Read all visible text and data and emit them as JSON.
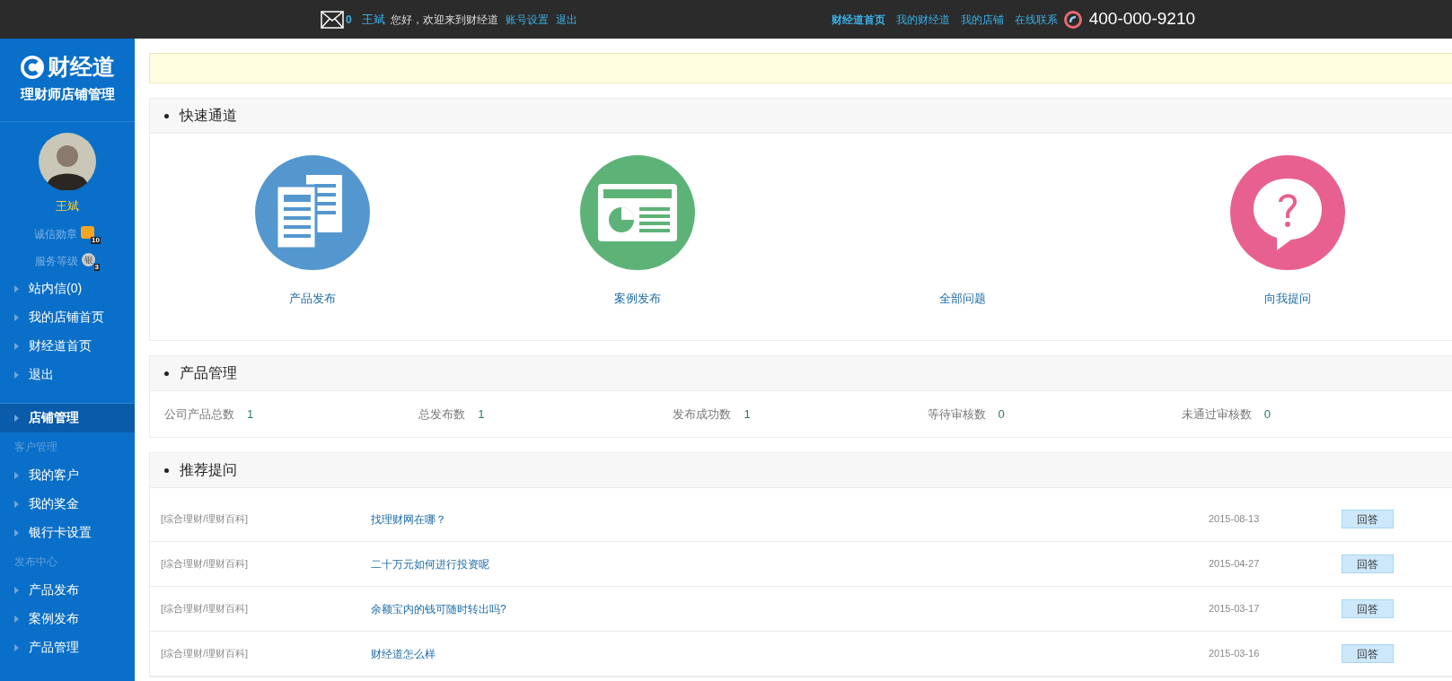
{
  "top_bar": {
    "mail_count": "0",
    "user": "王斌",
    "greeting": "您好，欢迎来到财经道",
    "links": [
      "账号设置",
      "退出"
    ],
    "nav": [
      {
        "label": "财经道首页",
        "selected": true
      },
      {
        "label": "我的财经道",
        "selected": false
      },
      {
        "label": "我的店铺",
        "selected": false
      },
      {
        "label": "在线联系",
        "selected": false
      }
    ],
    "phone": "400-000-9210"
  },
  "sidebar": {
    "logo": "财经道",
    "subtitle": "理财师店铺管理",
    "user_name": "王斌",
    "badges": [
      {
        "label": "诚信勋章",
        "kind": "medal",
        "count": "10"
      },
      {
        "label": "服务等级",
        "kind": "level",
        "glyph": "银",
        "count": "3"
      }
    ],
    "quick_links": [
      {
        "label": "站内信(0)"
      },
      {
        "label": "我的店铺首页"
      },
      {
        "label": "财经道首页"
      },
      {
        "label": "退出"
      }
    ],
    "menu": [
      {
        "kind": "item",
        "label": "店铺管理",
        "selected": true
      },
      {
        "kind": "group",
        "label": "客户管理"
      },
      {
        "kind": "item",
        "label": "我的客户",
        "selected": false
      },
      {
        "kind": "item",
        "label": "我的奖金",
        "selected": false
      },
      {
        "kind": "item",
        "label": "银行卡设置",
        "selected": false
      },
      {
        "kind": "group",
        "label": "发布中心"
      },
      {
        "kind": "item",
        "label": "产品发布",
        "selected": false
      },
      {
        "kind": "item",
        "label": "案例发布",
        "selected": false
      },
      {
        "kind": "item",
        "label": "产品管理",
        "selected": false
      }
    ]
  },
  "quick_channel": {
    "title": "快速通道",
    "items": [
      {
        "label": "产品发布",
        "kind": "documents"
      },
      {
        "label": "案例发布",
        "kind": "report"
      },
      {
        "label": "全部问题",
        "kind": "none"
      },
      {
        "label": "向我提问",
        "kind": "ask"
      }
    ]
  },
  "product_management": {
    "title": "产品管理",
    "stats": [
      {
        "label": "公司产品总数",
        "value": "1"
      },
      {
        "label": "总发布数",
        "value": "1"
      },
      {
        "label": "发布成功数",
        "value": "1"
      },
      {
        "label": "等待审核数",
        "value": "0"
      },
      {
        "label": "未通过审核数",
        "value": "0"
      }
    ]
  },
  "recommended_questions": {
    "title": "推荐提问",
    "rows": [
      {
        "category": "[综合理财/理财百科]",
        "question": "找理财网在哪？",
        "date": "2015-08-13",
        "action": "回答"
      },
      {
        "category": "[综合理财/理财百科]",
        "question": "二十万元如何进行投资呢",
        "date": "2015-04-27",
        "action": "回答"
      },
      {
        "category": "[综合理财/理财百科]",
        "question": "余额宝内的钱可随时转出吗?",
        "date": "2015-03-17",
        "action": "回答"
      },
      {
        "category": "[综合理财/理财百科]",
        "question": "财经道怎么样",
        "date": "2015-03-16",
        "action": "回答"
      }
    ]
  }
}
